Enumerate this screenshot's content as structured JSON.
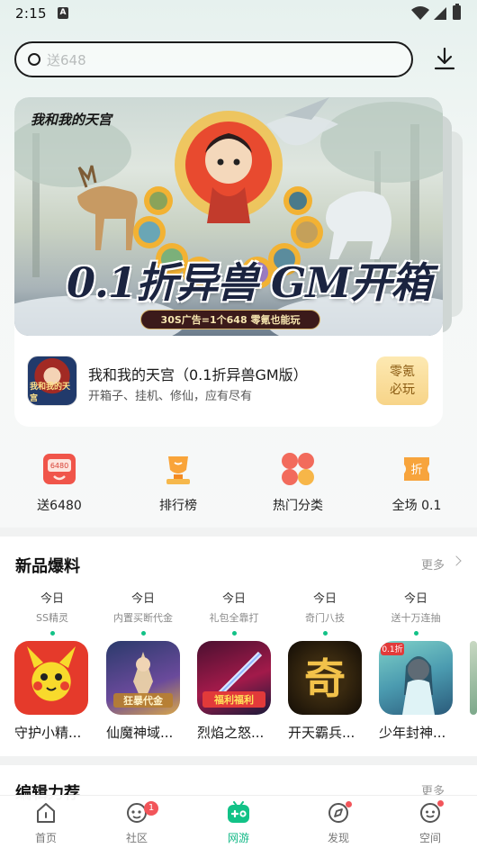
{
  "status_bar": {
    "time": "2:15",
    "notification_icon": "a-letter-icon"
  },
  "search": {
    "placeholder": "送648"
  },
  "banner": {
    "logo_text": "我和我的天宫",
    "headline": "0.1折异兽 GM开箱",
    "subline": "30S广告=1个648 零氪也能玩",
    "game_title": "我和我的天宫（0.1折异兽GM版）",
    "game_desc": "开箱子、挂机、修仙，应有尽有",
    "play_label_line1": "零氪",
    "play_label_line2": "必玩"
  },
  "quick_nav": [
    {
      "label": "送6480",
      "icon": "gift-card-icon"
    },
    {
      "label": "排行榜",
      "icon": "trophy-icon"
    },
    {
      "label": "热门分类",
      "icon": "category-grid-icon"
    },
    {
      "label": "全场 0.1",
      "icon": "discount-ticket-icon"
    }
  ],
  "new_section": {
    "title": "新品爆料",
    "more": "更多",
    "dates": [
      {
        "day": "今日",
        "sub": "SS精灵"
      },
      {
        "day": "今日",
        "sub": "内置买断代金"
      },
      {
        "day": "今日",
        "sub": "礼包全靠打"
      },
      {
        "day": "今日",
        "sub": "奇门八技"
      },
      {
        "day": "今日",
        "sub": "送十万连抽"
      }
    ],
    "apps": [
      {
        "name": "守护小精...",
        "icon_text": ""
      },
      {
        "name": "仙魔神域...",
        "icon_text": "狂暴代金"
      },
      {
        "name": "烈焰之怒...",
        "icon_text": "福利福利"
      },
      {
        "name": "开天霸兵...",
        "icon_text": "奇"
      },
      {
        "name": "少年封神...",
        "icon_text": "0.1折"
      }
    ]
  },
  "editor_section": {
    "title": "编辑力荐",
    "more": "更多"
  },
  "bottom_nav": [
    {
      "label": "首页",
      "badge": ""
    },
    {
      "label": "社区",
      "badge": "1"
    },
    {
      "label": "网游",
      "badge": ""
    },
    {
      "label": "发现",
      "badge": ""
    },
    {
      "label": "空间",
      "badge": ""
    }
  ],
  "colors": {
    "accent": "#12b886",
    "badge": "#f2555a",
    "play_button": "#f7d488"
  }
}
